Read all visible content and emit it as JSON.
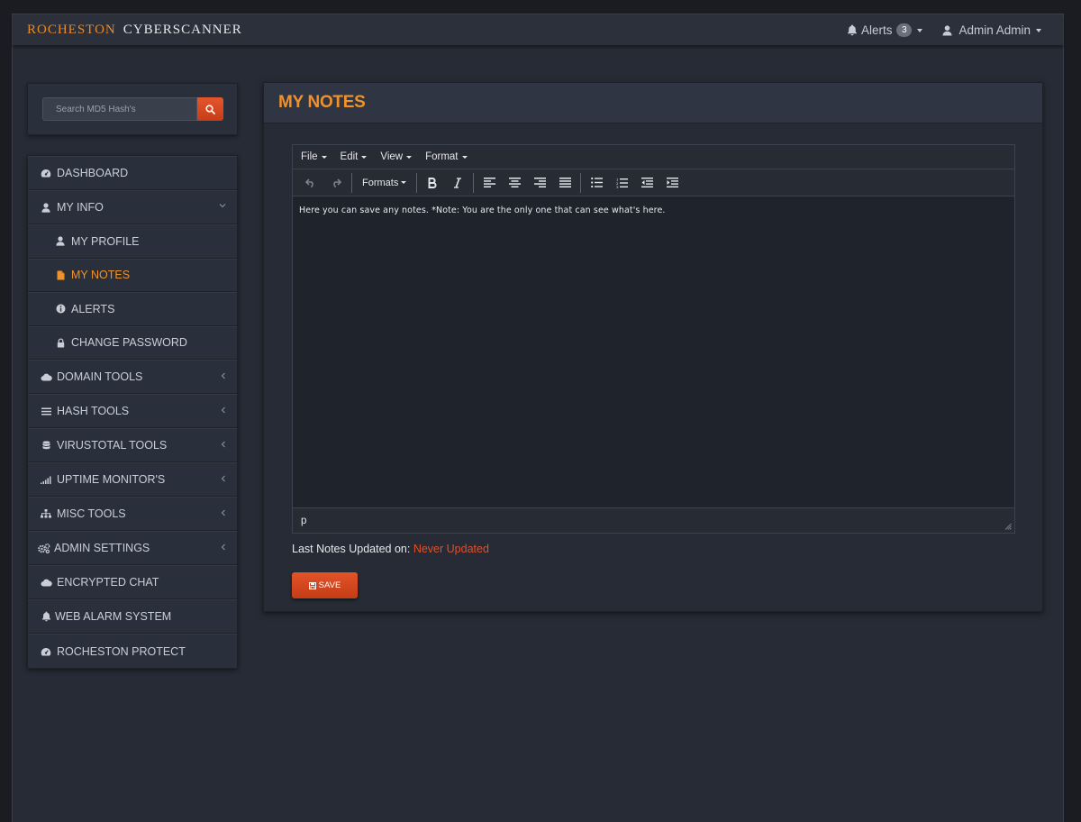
{
  "brand": {
    "part1": "ROCHESTON",
    "part2": "CYBERSCANNER"
  },
  "navbar": {
    "alerts_label": "Alerts",
    "alerts_count": "3",
    "user_label": "Admin Admin"
  },
  "search": {
    "placeholder": "Search MD5 Hash's"
  },
  "sidebar": {
    "items": [
      {
        "label": "DASHBOARD",
        "icon": "dashboard-icon"
      },
      {
        "label": "MY INFO",
        "icon": "user-icon"
      },
      {
        "label": "MY PROFILE",
        "icon": "user-icon"
      },
      {
        "label": "MY NOTES",
        "icon": "file-icon"
      },
      {
        "label": "ALERTS",
        "icon": "info-icon"
      },
      {
        "label": "CHANGE PASSWORD",
        "icon": "lock-icon"
      },
      {
        "label": "DOMAIN TOOLS",
        "icon": "cloud-icon"
      },
      {
        "label": "HASH TOOLS",
        "icon": "list-icon"
      },
      {
        "label": "VIRUSTOTAL TOOLS",
        "icon": "database-icon"
      },
      {
        "label": "UPTIME MONITOR'S",
        "icon": "signal-icon"
      },
      {
        "label": "MISC TOOLS",
        "icon": "sitemap-icon"
      },
      {
        "label": "ADMIN SETTINGS",
        "icon": "gears-icon"
      },
      {
        "label": "ENCRYPTED CHAT",
        "icon": "cloud-icon"
      },
      {
        "label": "WEB ALARM SYSTEM",
        "icon": "bell-icon"
      },
      {
        "label": "ROCHESTON PROTECT",
        "icon": "dashboard-icon"
      }
    ]
  },
  "panel": {
    "title": "MY NOTES"
  },
  "editor": {
    "menus": [
      "File",
      "Edit",
      "View",
      "Format"
    ],
    "formats_label": "Formats",
    "content": "Here you can save any notes. *Note: You are the only one that can see what's here.",
    "status_path": "p"
  },
  "updated": {
    "label": "Last Notes Updated on:",
    "value": "Never Updated"
  },
  "save_label": "SAVE",
  "colors": {
    "accent": "#f0922b",
    "button": "#d6461f",
    "never_updated": "#e0502a"
  }
}
